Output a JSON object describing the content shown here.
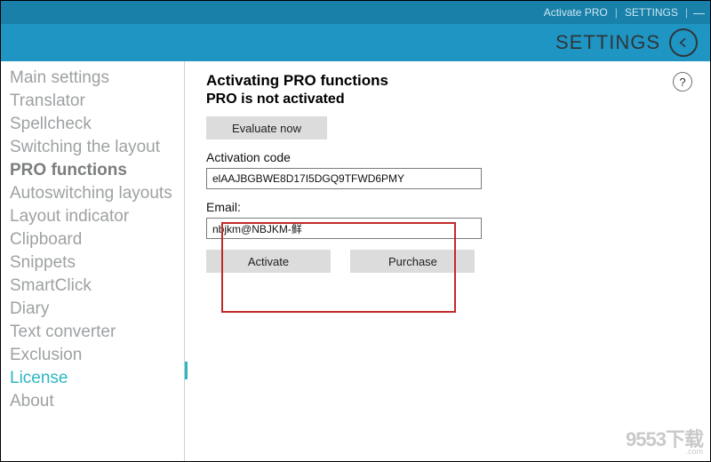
{
  "toplinks": {
    "activate": "Activate PRO",
    "settings": "SETTINGS"
  },
  "header": {
    "title": "SETTINGS"
  },
  "sidebar": {
    "items": [
      {
        "label": "Main settings"
      },
      {
        "label": "Translator"
      },
      {
        "label": "Spellcheck"
      },
      {
        "label": "Switching the layout"
      },
      {
        "label": "PRO functions",
        "bold": true
      },
      {
        "label": "Autoswitching layouts"
      },
      {
        "label": "Layout indicator"
      },
      {
        "label": "Clipboard"
      },
      {
        "label": "Snippets"
      },
      {
        "label": "SmartClick"
      },
      {
        "label": "Diary"
      },
      {
        "label": "Text converter"
      },
      {
        "label": "Exclusion"
      },
      {
        "label": "License",
        "active": true
      },
      {
        "label": "About"
      }
    ]
  },
  "main": {
    "heading": "Activating PRO functions",
    "status": "PRO is not activated",
    "evaluate_label": "Evaluate now",
    "code_label": "Activation code",
    "code_value": "elAAJBGBWE8D17I5DGQ9TFWD6PMY",
    "email_label": "Email:",
    "email_value": "nbjkm@NBJKM-鲜",
    "activate_label": "Activate",
    "purchase_label": "Purchase",
    "help_tooltip": "?"
  },
  "watermark": {
    "line1": "9553下载",
    "line2": ".com"
  },
  "colors": {
    "header": "#1f95c4",
    "accent": "#2bb7c4",
    "redbox": "#c22a2a"
  }
}
